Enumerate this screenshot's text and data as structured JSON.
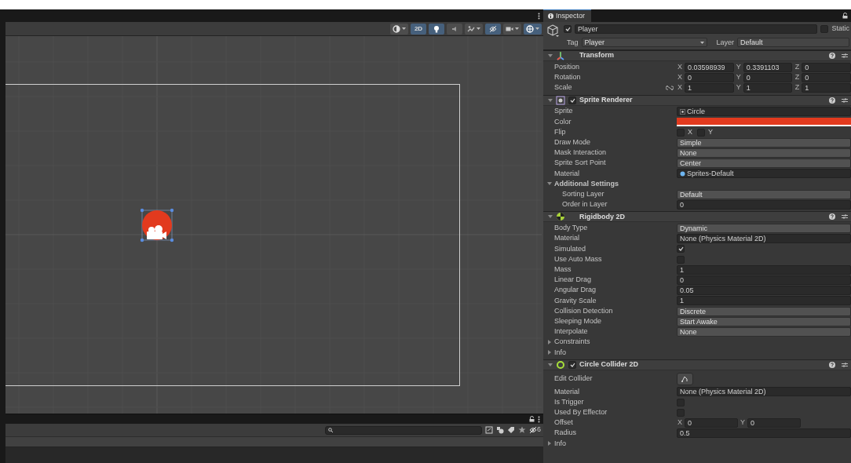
{
  "scene_toolbar": [
    {
      "kind": "shading",
      "selected": false
    },
    {
      "kind": "mode2d",
      "label": "2D",
      "selected": true
    },
    {
      "kind": "lighting",
      "selected": true
    },
    {
      "kind": "audio",
      "selected": false
    },
    {
      "kind": "effects",
      "selected": false
    },
    {
      "kind": "visibility",
      "selected": true
    },
    {
      "kind": "camera",
      "selected": false
    },
    {
      "kind": "gizmos",
      "selected": true
    }
  ],
  "inspector": {
    "tab": "Inspector",
    "object": {
      "name": "Player",
      "active": true,
      "static_label": "Static",
      "static": false,
      "tag_label": "Tag",
      "tag": "Player",
      "layer_label": "Layer",
      "layer": "Default"
    },
    "components": [
      {
        "kind": "transform",
        "name": "Transform",
        "expanded": true,
        "rows": [
          {
            "kind": "vector",
            "label": "Position",
            "axes": [
              {
                "axis": "X",
                "value": "0.03598939"
              },
              {
                "axis": "Y",
                "value": "0.3391103"
              },
              {
                "axis": "Z",
                "value": "0"
              }
            ]
          },
          {
            "kind": "vector",
            "label": "Rotation",
            "axes": [
              {
                "axis": "X",
                "value": "0"
              },
              {
                "axis": "Y",
                "value": "0"
              },
              {
                "axis": "Z",
                "value": "0"
              }
            ]
          },
          {
            "kind": "vector",
            "label": "Scale",
            "constrain_proportions": false,
            "axes": [
              {
                "axis": "X",
                "value": "1"
              },
              {
                "axis": "Y",
                "value": "1"
              },
              {
                "axis": "Z",
                "value": "1"
              }
            ]
          }
        ]
      },
      {
        "kind": "sprite",
        "name": "Sprite Renderer",
        "enabled": true,
        "expanded": true,
        "rows": [
          {
            "kind": "sprite",
            "label": "Sprite",
            "value": "Circle"
          },
          {
            "kind": "color",
            "label": "Color",
            "color": "#e23a1e"
          },
          {
            "kind": "flip",
            "label": "Flip",
            "toggles": [
              {
                "axis": "X",
                "checked": false
              },
              {
                "axis": "Y",
                "checked": false
              }
            ]
          },
          {
            "kind": "dropdown",
            "label": "Draw Mode",
            "value": "Simple"
          },
          {
            "kind": "dropdown",
            "label": "Mask Interaction",
            "value": "None"
          },
          {
            "kind": "dropdown",
            "label": "Sprite Sort Point",
            "value": "Center"
          },
          {
            "kind": "material",
            "label": "Material",
            "value": "Sprites-Default"
          },
          {
            "kind": "foldout",
            "label": "Additional Settings",
            "expanded": true,
            "children": [
              {
                "kind": "dropdown",
                "label": "Sorting Layer",
                "value": "Default"
              },
              {
                "kind": "text",
                "label": "Order in Layer",
                "value": "0"
              }
            ]
          }
        ]
      },
      {
        "kind": "rigidbody",
        "name": "Rigidbody 2D",
        "expanded": true,
        "rows": [
          {
            "kind": "dropdown",
            "label": "Body Type",
            "value": "Dynamic"
          },
          {
            "kind": "object",
            "label": "Material",
            "value": "None (Physics Material 2D)"
          },
          {
            "kind": "checkbox",
            "label": "Simulated",
            "checked": true
          },
          {
            "kind": "checkbox",
            "label": "Use Auto Mass",
            "checked": false
          },
          {
            "kind": "text",
            "label": "Mass",
            "value": "1"
          },
          {
            "kind": "text",
            "label": "Linear Drag",
            "value": "0"
          },
          {
            "kind": "text",
            "label": "Angular Drag",
            "value": "0.05"
          },
          {
            "kind": "text",
            "label": "Gravity Scale",
            "value": "1"
          },
          {
            "kind": "dropdown",
            "label": "Collision Detection",
            "value": "Discrete"
          },
          {
            "kind": "dropdown",
            "label": "Sleeping Mode",
            "value": "Start Awake"
          },
          {
            "kind": "dropdown",
            "label": "Interpolate",
            "value": "None"
          },
          {
            "kind": "foldout",
            "label": "Constraints",
            "expanded": false
          },
          {
            "kind": "foldout",
            "label": "Info",
            "expanded": false
          }
        ]
      },
      {
        "kind": "collider",
        "name": "Circle Collider 2D",
        "enabled": true,
        "expanded": true,
        "rows": [
          {
            "kind": "button",
            "label": "Edit Collider"
          },
          {
            "kind": "object",
            "label": "Material",
            "value": "None (Physics Material 2D)"
          },
          {
            "kind": "checkbox",
            "label": "Is Trigger",
            "checked": false
          },
          {
            "kind": "checkbox",
            "label": "Used By Effector",
            "checked": false
          },
          {
            "kind": "vector",
            "label": "Offset",
            "axes": [
              {
                "axis": "X",
                "value": "0"
              },
              {
                "axis": "Y",
                "value": "0"
              }
            ]
          },
          {
            "kind": "text",
            "label": "Radius",
            "value": "0.5"
          },
          {
            "kind": "foldout",
            "label": "Info",
            "expanded": false
          }
        ]
      }
    ]
  },
  "project_panel": {
    "hidden_count": "6"
  }
}
